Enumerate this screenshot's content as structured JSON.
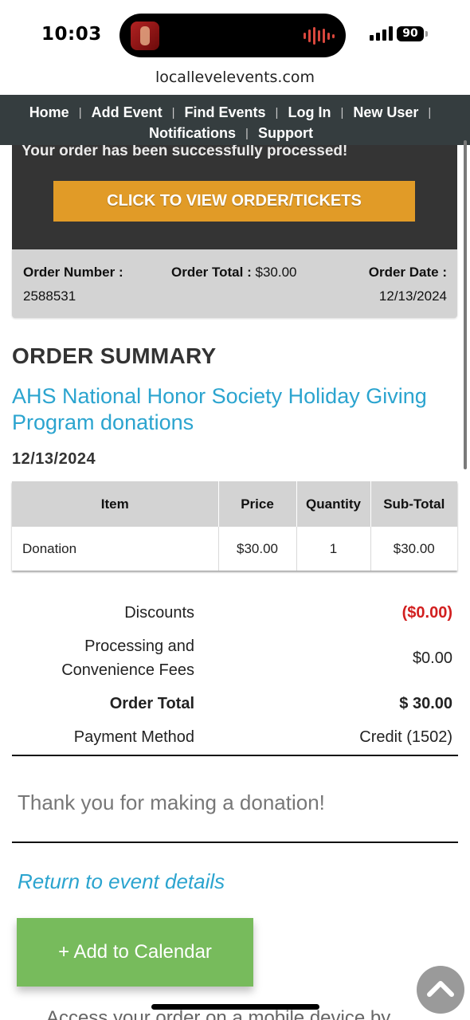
{
  "status_bar": {
    "time": "10:03",
    "battery": "90"
  },
  "browser": {
    "url": "locallevelevents.com"
  },
  "nav": {
    "row1": [
      "Home",
      "Add Event",
      "Find Events",
      "Log In",
      "New User"
    ],
    "row2": [
      "Notifications",
      "Support"
    ]
  },
  "banner": {
    "message": "Your order has been successfully processed!",
    "view_button": "CLICK TO VIEW ORDER/TICKETS"
  },
  "order_info": {
    "number_label": "Order Number :",
    "number": "2588531",
    "total_label": "Order Total :",
    "total": "$30.00",
    "date_label": "Order Date :",
    "date": "12/13/2024"
  },
  "summary": {
    "title": "ORDER SUMMARY",
    "event_title": "AHS National Honor Society Holiday Giving Program donations",
    "event_date": "12/13/2024"
  },
  "items_table": {
    "headers": [
      "Item",
      "Price",
      "Quantity",
      "Sub-Total"
    ],
    "rows": [
      [
        "Donation",
        "$30.00",
        "1",
        "$30.00"
      ]
    ]
  },
  "totals": {
    "discounts_label": "Discounts",
    "discounts_value": "($0.00)",
    "fees_label_line1": "Processing and",
    "fees_label_line2": "Convenience Fees",
    "fees_value": "$0.00",
    "order_total_label": "Order Total",
    "order_total_value": "$ 30.00",
    "payment_label": "Payment Method",
    "payment_value": "Credit (1502)"
  },
  "thanks_message": "Thank you for making a donation!",
  "return_link": "Return to event details",
  "calendar_button": "+ Add to Calendar",
  "footer_text": "Access your order on a mobile device by",
  "colors": {
    "nav_bg": "#353d3f",
    "banner_bg": "#343434",
    "button_orange": "#e19b27",
    "link_blue": "#2ba4cf",
    "discount_red": "#d21f1f",
    "calendar_green": "#77bb5c"
  },
  "icons": {
    "scroll_top": "chevron-up-icon",
    "signal": "cellular-signal-icon",
    "battery": "battery-icon"
  }
}
